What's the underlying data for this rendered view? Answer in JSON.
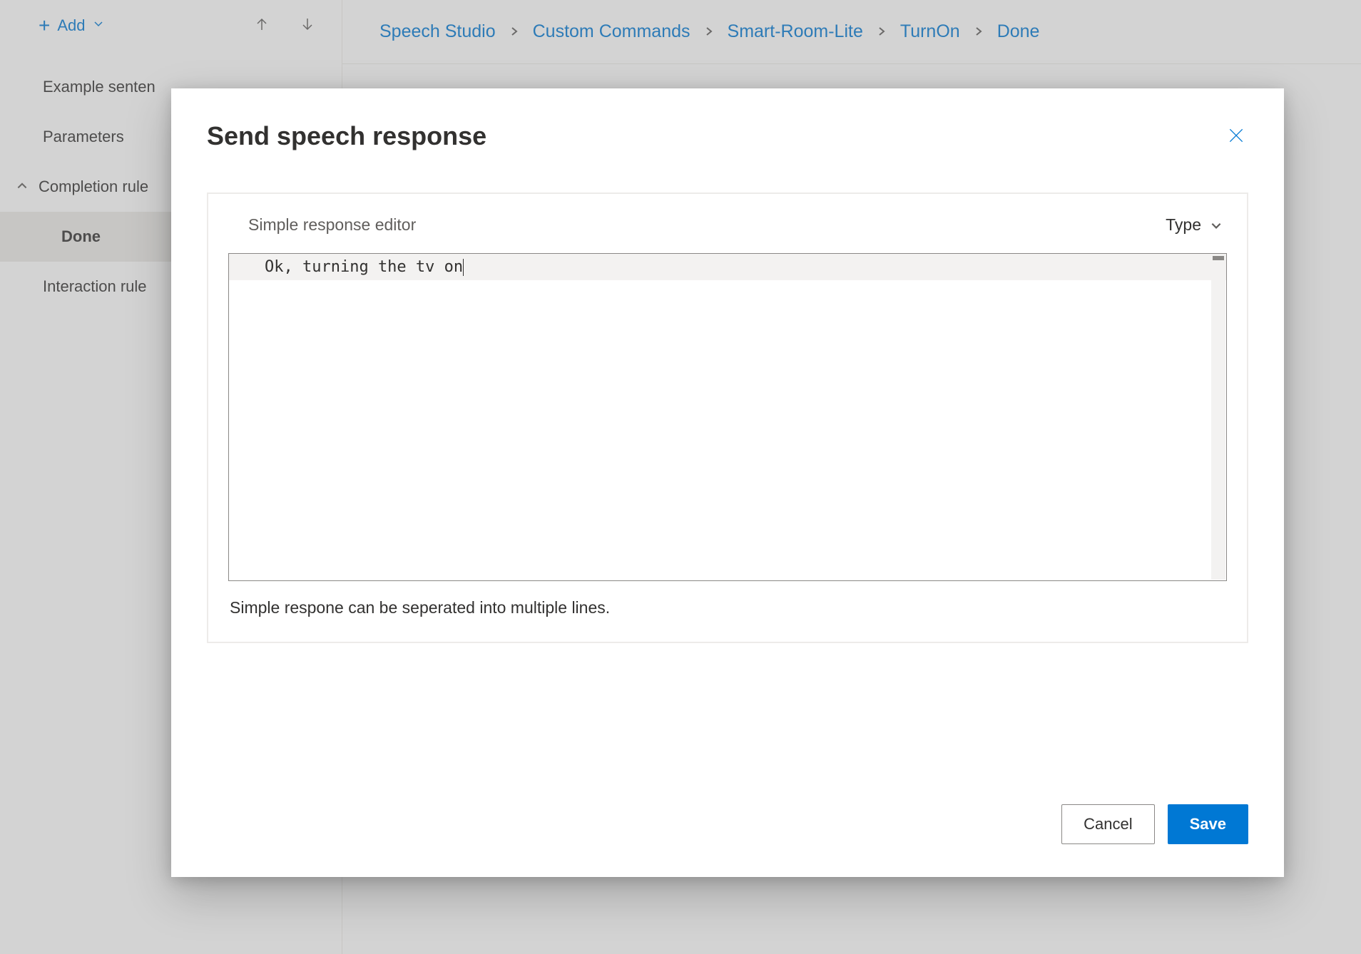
{
  "sidebar": {
    "add_label": "Add",
    "items": {
      "example_sentences": "Example senten",
      "parameters": "Parameters",
      "completion_rules": "Completion rule",
      "done": "Done",
      "interaction_rules": "Interaction rule"
    }
  },
  "breadcrumb": {
    "items": [
      "Speech Studio",
      "Custom Commands",
      "Smart-Room-Lite",
      "TurnOn",
      "Done"
    ]
  },
  "modal": {
    "title": "Send speech response",
    "editor_label": "Simple response editor",
    "type_label": "Type",
    "response_text": "Ok, turning the tv on",
    "helper_text": "Simple respone can be seperated into multiple lines.",
    "cancel_label": "Cancel",
    "save_label": "Save"
  }
}
